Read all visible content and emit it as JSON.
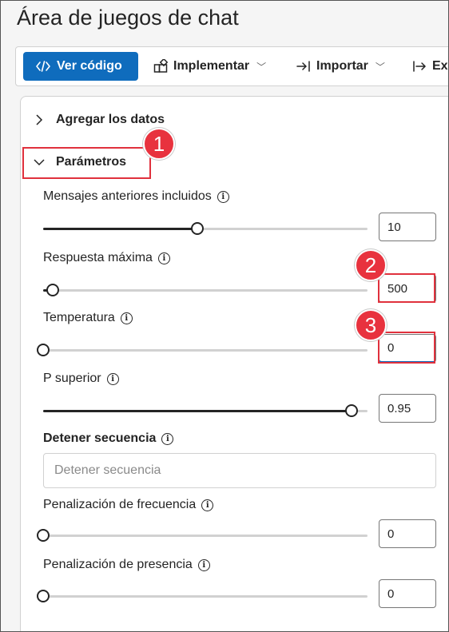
{
  "page": {
    "title": "Área de juegos de chat"
  },
  "toolbar": {
    "view_code": "Ver código",
    "deploy": "Implementar",
    "import": "Importar",
    "export": "Ex"
  },
  "sections": {
    "add_data": "Agregar los datos",
    "parameters": "Parámetros"
  },
  "params": {
    "past_messages": {
      "label": "Mensajes anteriores incluidos",
      "value": "10",
      "fraction": 0.475
    },
    "max_response": {
      "label": "Respuesta máxima",
      "value": "500",
      "fraction": 0.03
    },
    "temperature": {
      "label": "Temperatura",
      "value": "0",
      "fraction": 0
    },
    "top_p": {
      "label": "P superior",
      "value": "0.95",
      "fraction": 0.95
    },
    "stop_sequence": {
      "label": "Detener secuencia",
      "placeholder": "Detener secuencia"
    },
    "frequency_penalty": {
      "label": "Penalización de frecuencia",
      "value": "0",
      "fraction": 0
    },
    "presence_penalty": {
      "label": "Penalización de presencia",
      "value": "0",
      "fraction": 0
    }
  },
  "callouts": {
    "one": "1",
    "two": "2",
    "three": "3"
  },
  "colors": {
    "accent": "#0f6cbd",
    "highlight": "#e0313d"
  }
}
